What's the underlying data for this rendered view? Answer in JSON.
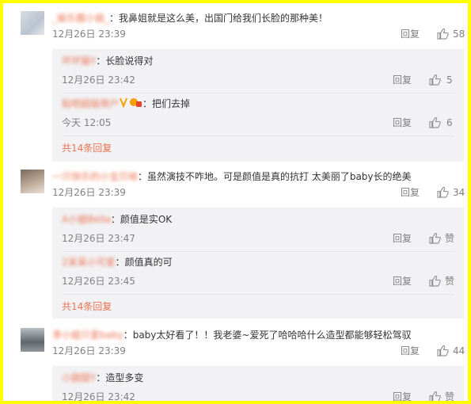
{
  "comments": [
    {
      "username": "_娱乐圈小姐_",
      "text": "：我鼻姐就是这么美，出国门给我们长脸的那种美！",
      "time": "12月26日 23:39",
      "reply_label": "回复",
      "likes": "58",
      "replies": [
        {
          "username": "坏坏猫Y",
          "text": "：长脸说得对",
          "time": "12月26日 23:42",
          "reply_label": "回复",
          "likes": "5"
        },
        {
          "username": "贴吧超级用户",
          "text": "：把们去掉",
          "time": "今天 12:05",
          "reply_label": "回复",
          "likes": "6",
          "badge_icon": "verified-v-icon"
        }
      ],
      "more_label": "共14条回复"
    },
    {
      "username": "一只快乐的小宝贝呦",
      "text": "：虽然演技不咋地。可是颜值是真的抗打 太美丽了baby长的绝美",
      "time": "12月26日 23:39",
      "reply_label": "回复",
      "likes": "34",
      "replies": [
        {
          "username": "A小姐Bella",
          "text": "：颜值是实OK",
          "time": "12月26日 23:47",
          "reply_label": "回复",
          "likes": "赞"
        },
        {
          "username": "2呆呆小可爱",
          "text": "：颜值真的可",
          "time": "12月26日 23:45",
          "reply_label": "回复",
          "likes": "赞"
        }
      ],
      "more_label": "共14条回复"
    },
    {
      "username": "李小姐只爱baby",
      "text": "：baby太好看了！！我老婆~爱死了哈哈哈什么造型都能够轻松驾驭",
      "time": "12月26日 23:39",
      "reply_label": "回复",
      "likes": "44",
      "replies": [
        {
          "username": "小甜甜Y",
          "text": "：造型多变",
          "time": "12月26日 23:42",
          "reply_label": "回复",
          "likes": "赞"
        }
      ]
    }
  ],
  "colors": {
    "frame": "#ffff00",
    "username": "#eb7350",
    "meta": "#808080",
    "sub_bg": "#f2f2f5"
  }
}
